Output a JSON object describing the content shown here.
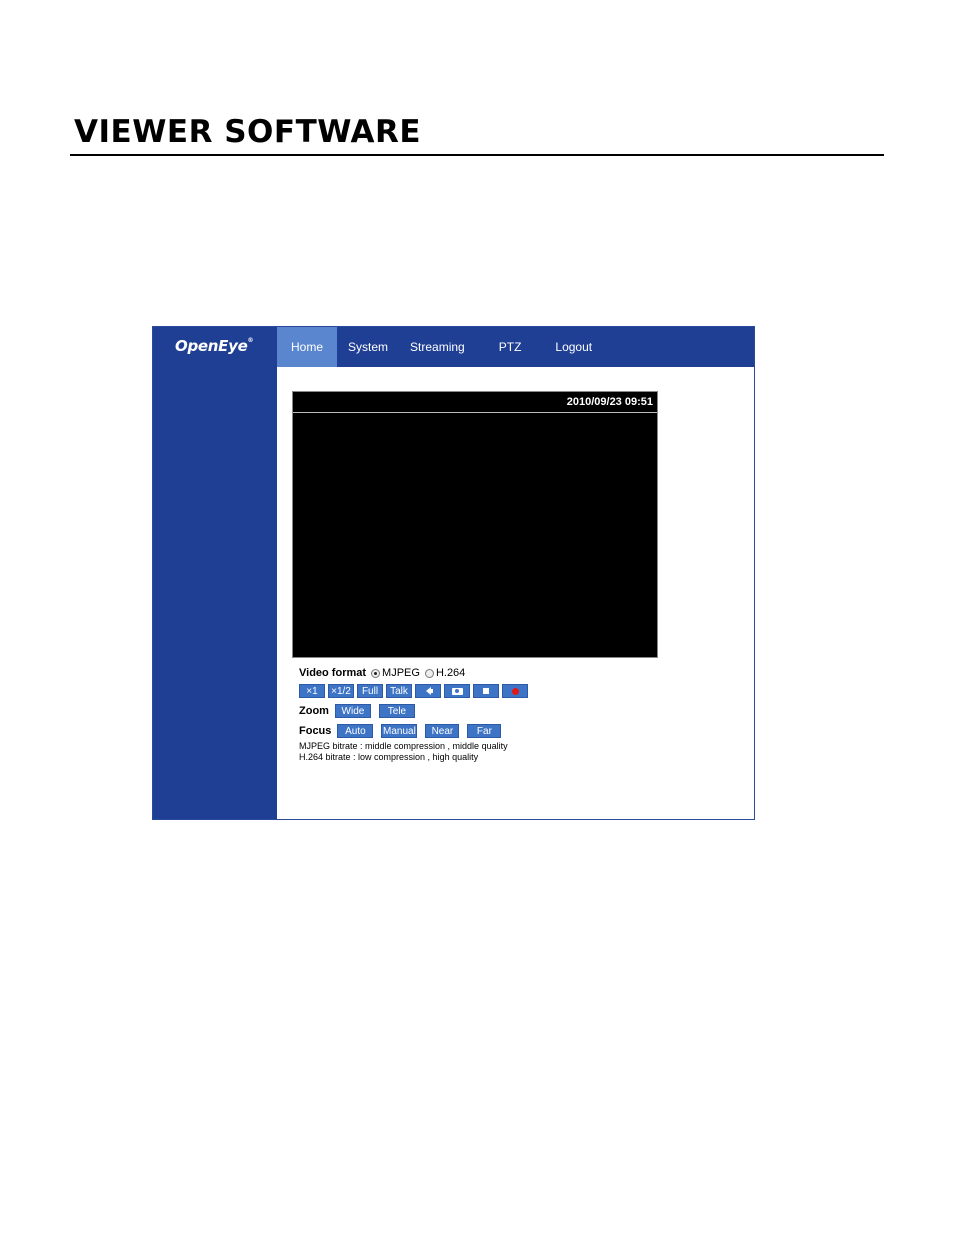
{
  "page": {
    "heading": "VIEWER SOFTWARE"
  },
  "app": {
    "logo": "OpenEye",
    "logo_mark": "®",
    "nav": [
      {
        "label": "Home",
        "active": true
      },
      {
        "label": "System"
      },
      {
        "label": "Streaming"
      },
      {
        "label": "PTZ"
      },
      {
        "label": "Logout"
      }
    ],
    "video": {
      "timestamp": "2010/09/23 09:51"
    },
    "controls": {
      "video_format_label": "Video format",
      "format_options": [
        "MJPEG",
        "H.264"
      ],
      "format_selected": "MJPEG",
      "buttons": {
        "x1": "×1",
        "x_half": "×1/2",
        "full": "Full",
        "talk": "Talk",
        "speaker_icon": "speaker-icon",
        "snapshot_icon": "camera-icon",
        "stop_icon": "stop-icon",
        "record_icon": "record-icon"
      },
      "zoom_label": "Zoom",
      "zoom_wide": "Wide",
      "zoom_tele": "Tele",
      "focus_label": "Focus",
      "focus_auto": "Auto",
      "focus_manual": "Manual",
      "focus_near": "Near",
      "focus_far": "Far",
      "mjpeg_info": "MJPEG bitrate : middle compression , middle quality",
      "h264_info": "H.264 bitrate : low compression , high quality"
    },
    "colors": {
      "nav_bg": "#1f3f94",
      "nav_active": "#5a85cf",
      "button": "#3e74c5",
      "record": "#e01818"
    }
  }
}
